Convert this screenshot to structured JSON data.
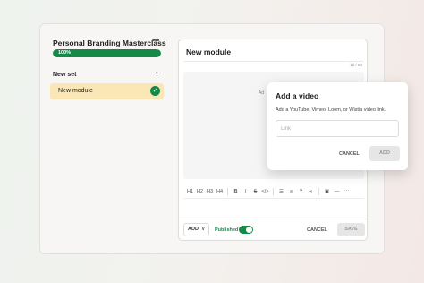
{
  "sidebar": {
    "course_title": "Personal Branding Masterclass",
    "more_icon": "more-horizontal-icon",
    "progress": {
      "value": 1.0,
      "label": "100%"
    },
    "section": {
      "title": "New set",
      "chevron_icon": "chevron-up-icon"
    },
    "module": {
      "label": "New module",
      "status_icon": "check-circle-icon"
    }
  },
  "editor": {
    "title": "New module",
    "char_count": "10 / 80",
    "video_hint": "Ad",
    "toolbar": [
      "H1",
      "H2",
      "H3",
      "H4",
      "B",
      "I",
      "S",
      "</>",
      "list-bulleted-icon",
      "list-numbered-icon",
      "quote-icon",
      "link-icon",
      "image-icon",
      "horizontal-rule-icon"
    ],
    "toolbar_text": {
      "h1": "H1",
      "h2": "H2",
      "h3": "H3",
      "h4": "H4",
      "bold": "B",
      "italic": "I",
      "strike": "S",
      "code": "</>"
    },
    "footer": {
      "add_label": "ADD",
      "published_label": "Published",
      "cancel_label": "CANCEL",
      "save_label": "SAVE"
    }
  },
  "modal": {
    "title": "Add a video",
    "description": "Add a YouTube, Vimeo, Loom, or Wistia video link.",
    "input_placeholder": "Link",
    "cancel_label": "CANCEL",
    "add_label": "ADD"
  },
  "colors": {
    "accent": "#138a48",
    "highlight": "#fbe7b5"
  }
}
